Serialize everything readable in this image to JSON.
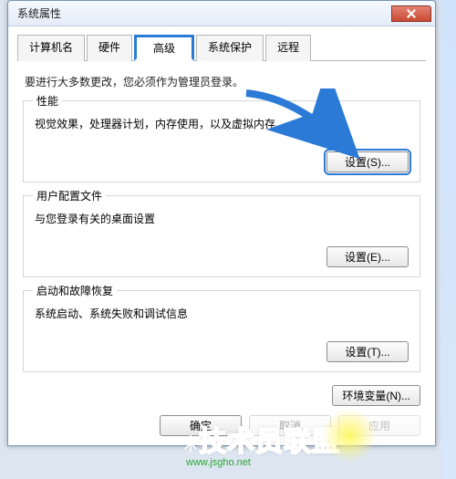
{
  "window": {
    "title": "系统属性"
  },
  "tabs": {
    "t0": "计算机名",
    "t1": "硬件",
    "t2": "高级",
    "t3": "系统保护",
    "t4": "远程"
  },
  "intro": "要进行大多数更改，您必须作为管理员登录。",
  "groups": {
    "perf": {
      "title": "性能",
      "desc": "视觉效果，处理器计划，内存使用，以及虚拟内存",
      "btn": "设置(S)..."
    },
    "profile": {
      "title": "用户配置文件",
      "desc": "与您登录有关的桌面设置",
      "btn": "设置(E)..."
    },
    "recovery": {
      "title": "启动和故障恢复",
      "desc": "系统启动、系统失败和调试信息",
      "btn": "设置(T)..."
    }
  },
  "env_btn": "环境变量(N)...",
  "dialog": {
    "ok": "确定",
    "cancel": "取消",
    "apply": "应用"
  },
  "watermark": {
    "text": "技术员联盟",
    "url": "www.jsgho.net"
  }
}
